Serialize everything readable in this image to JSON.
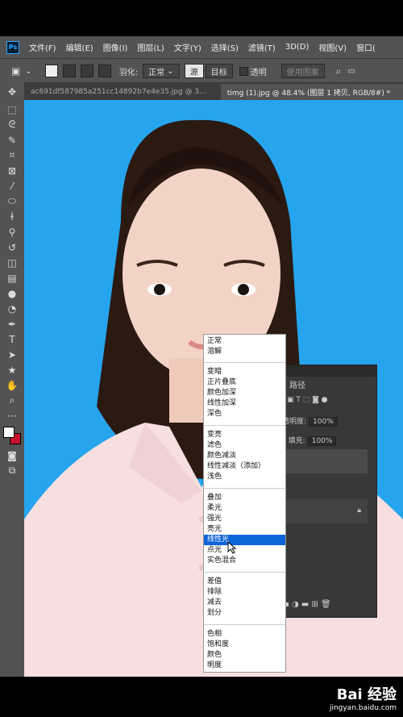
{
  "app": {
    "logo": "Ps"
  },
  "menu": [
    "文件(F)",
    "编辑(E)",
    "图像(I)",
    "图层(L)",
    "文字(Y)",
    "选择(S)",
    "滤镜(T)",
    "3D(D)",
    "视图(V)",
    "窗口("
  ],
  "options": {
    "feather_label": "羽化:",
    "mode_value": "正常",
    "source_label": "源",
    "target_label": "目标",
    "transparent_label": "透明",
    "use_pattern_label": "使用图案"
  },
  "tabs": [
    {
      "label": "ac691df587985a251cc14892b7e4e35.jpg @ 3…",
      "active": false
    },
    {
      "label": "timg (1).jpg @ 48.4% (图层 1 拷贝, RGB/8#) *",
      "active": true
    }
  ],
  "layers_panel": {
    "tab_label": "路径",
    "opacity_label": "透明度:",
    "opacity_value": "100%",
    "fill_label": "填充:",
    "fill_value": "100%"
  },
  "blend_groups": [
    [
      "正常",
      "溶解"
    ],
    [
      "变暗",
      "正片叠底",
      "颜色加深",
      "线性加深",
      "深色"
    ],
    [
      "变亮",
      "滤色",
      "颜色减淡",
      "线性减淡（添加）",
      "浅色"
    ],
    [
      "叠加",
      "柔光",
      "强光",
      "亮光",
      "线性光",
      "点光",
      "实色混合"
    ],
    [
      "差值",
      "排除",
      "减去",
      "划分"
    ],
    [
      "色相",
      "饱和度",
      "颜色",
      "明度"
    ]
  ],
  "selected_blend_mode": "线性光",
  "watermark": {
    "brand": "Bai 经验",
    "url": "jingyan.baidu.com"
  },
  "colors": {
    "canvas_bg": "#27a4ee",
    "ui_panel": "#535353",
    "selection": "#0d65d8"
  }
}
